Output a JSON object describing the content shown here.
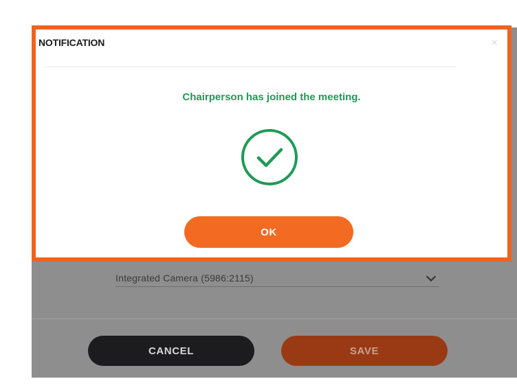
{
  "settings_dialog": {
    "camera_select": {
      "value": "Integrated Camera (5986:2115)"
    },
    "cancel_label": "CANCEL",
    "save_label": "SAVE"
  },
  "notification": {
    "title": "NOTIFICATION",
    "close_glyph": "×",
    "message": "Chairperson has joined the meeting.",
    "icon": "check-circle-icon",
    "ok_label": "OK"
  },
  "colors": {
    "accent_orange": "#f0621d",
    "success_green": "#1e9a55",
    "cancel_dark": "#1c1c1e"
  }
}
